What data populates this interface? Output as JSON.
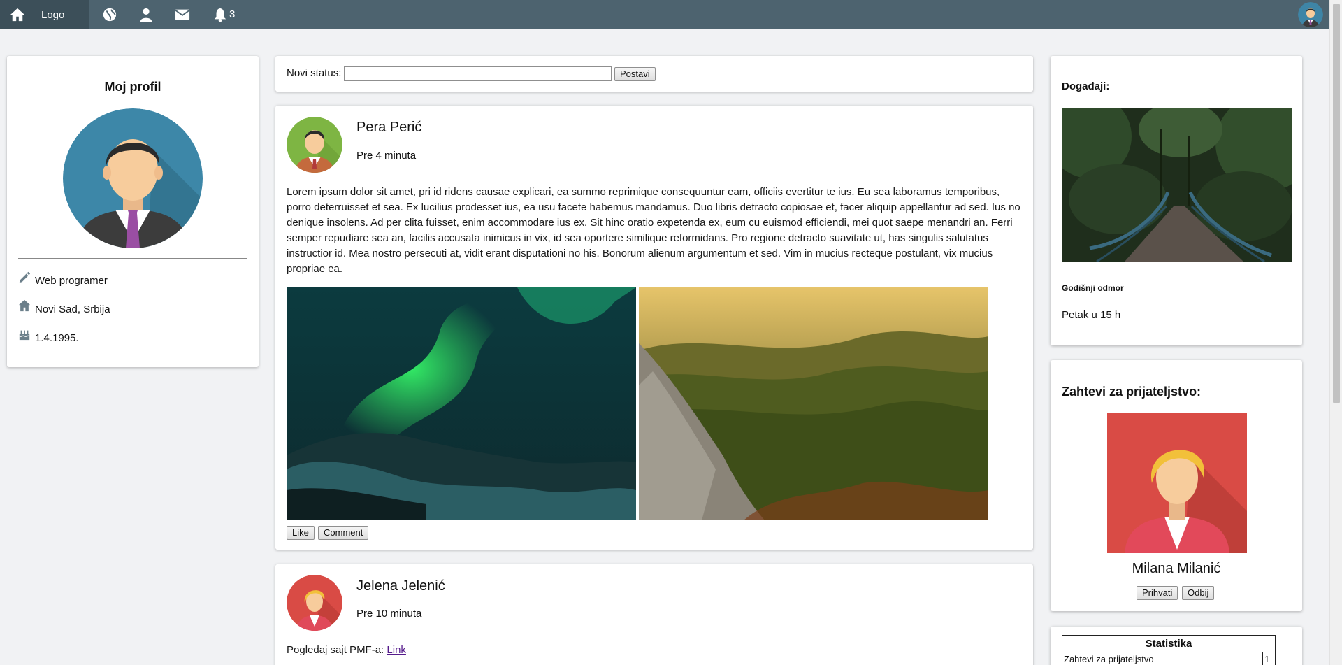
{
  "nav": {
    "logo": "Logo",
    "notification_count": "3",
    "icons": [
      "home-icon",
      "globe-icon",
      "user-icon",
      "mail-icon",
      "bell-icon"
    ]
  },
  "profile": {
    "title": "Moj profil",
    "job": "Web programer",
    "location": "Novi Sad, Srbija",
    "birthday": "1.4.1995."
  },
  "status": {
    "label": "Novi status:",
    "value": "",
    "submit": "Postavi"
  },
  "posts": [
    {
      "author": "Pera Perić",
      "time": "Pre 4 minuta",
      "text": "Lorem ipsum dolor sit amet, pri id ridens causae explicari, ea summo reprimique consequuntur eam, officiis evertitur te ius. Eu sea laboramus temporibus, porro deterruisset et sea. Ex lucilius prodesset ius, ea usu facete habemus mandamus. Duo libris detracto copiosae et, facer aliquip appellantur ad sed. Ius no denique insolens. Ad per clita fuisset, enim accommodare ius ex. Sit hinc oratio expetenda ex, eum cu euismod efficiendi, mei quot saepe menandri an. Ferri semper repudiare sea an, facilis accusata inimicus in vix, id sea oportere similique reformidans. Pro regione detracto suavitate ut, has singulis salutatus instructior id. Mea nostro persecuti at, vidit erant disputationi no his. Bonorum alienum argumentum et sed. Vim in mucius recteque postulant, vix mucius propriae ea.",
      "like": "Like",
      "comment": "Comment"
    },
    {
      "author": "Jelena Jelenić",
      "time": "Pre 10 minuta",
      "text_prefix": "Pogledaj sajt PMF-a:",
      "link": "Link"
    }
  ],
  "events": {
    "title": "Događaji:",
    "name": "Godišnji odmor",
    "time": "Petak u 15 h"
  },
  "friend_requests": {
    "title": "Zahtevi za prijateljstvo:",
    "name": "Milana Milanić",
    "accept": "Prihvati",
    "decline": "Odbij"
  },
  "stats": {
    "title": "Statistika",
    "rows": [
      {
        "label": "Zahtevi za prijateljstvo",
        "value": "1"
      }
    ]
  }
}
